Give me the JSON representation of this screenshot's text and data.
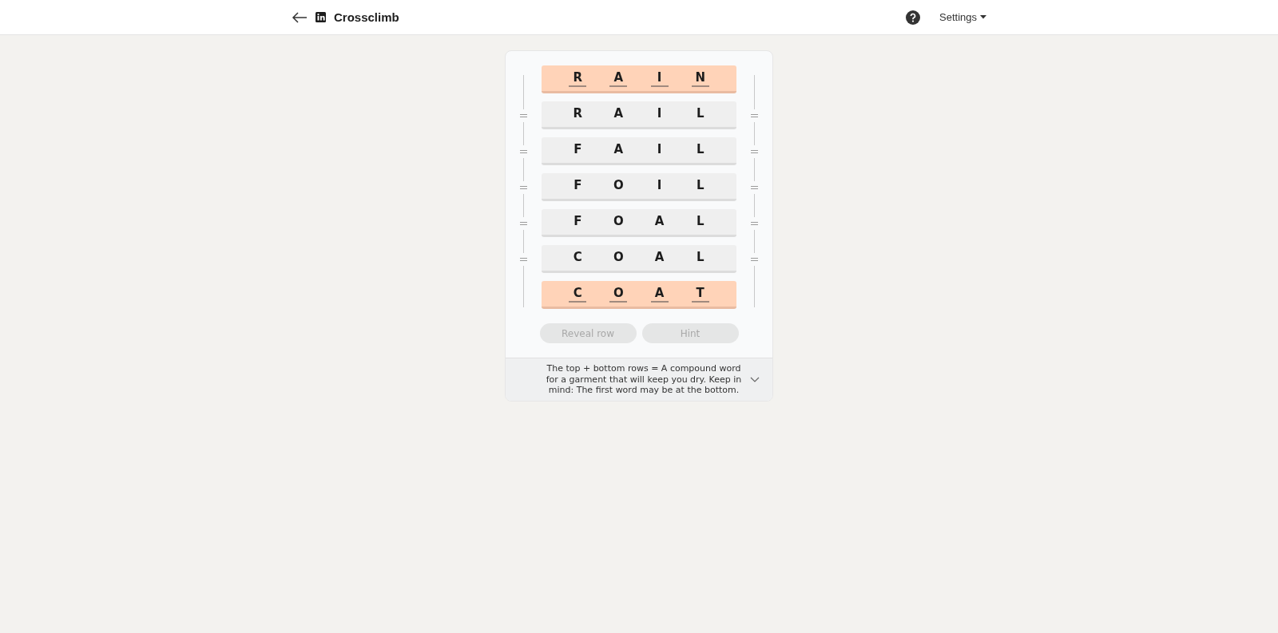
{
  "header": {
    "title": "Crossclimb",
    "menu": "Settings"
  },
  "rows": [
    {
      "kind": "locked",
      "letters": [
        "R",
        "A",
        "I",
        "N"
      ]
    },
    {
      "kind": "normal",
      "letters": [
        "R",
        "A",
        "I",
        "L"
      ]
    },
    {
      "kind": "normal",
      "letters": [
        "F",
        "A",
        "I",
        "L"
      ]
    },
    {
      "kind": "normal",
      "letters": [
        "F",
        "O",
        "I",
        "L"
      ]
    },
    {
      "kind": "normal",
      "letters": [
        "F",
        "O",
        "A",
        "L"
      ]
    },
    {
      "kind": "normal",
      "letters": [
        "C",
        "O",
        "A",
        "L"
      ]
    },
    {
      "kind": "locked",
      "letters": [
        "C",
        "O",
        "A",
        "T"
      ]
    }
  ],
  "buttons": [
    {
      "label": "Reveal row",
      "disabled": true
    },
    {
      "label": "Hint",
      "disabled": true
    }
  ],
  "clue": {
    "text": "The top + bottom rows = A compound word for a garment that will keep you dry. Keep in mind: The first word may be at the bottom.",
    "expanded": false
  }
}
